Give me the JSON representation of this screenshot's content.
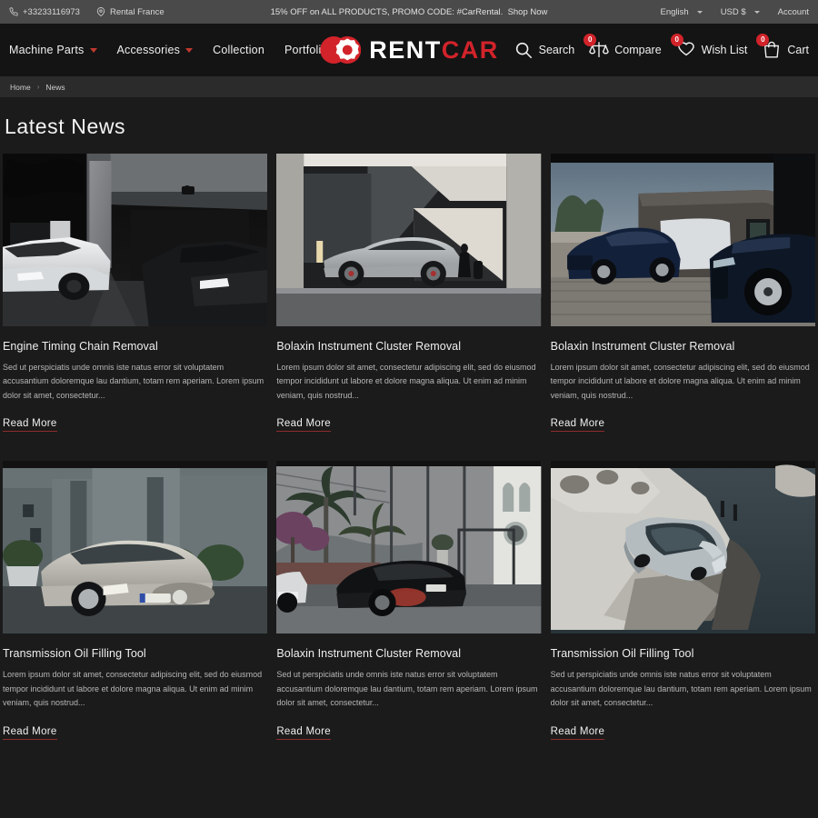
{
  "topbar": {
    "phone": "+33233116973",
    "location": "Rental France",
    "promo": "15% OFF on ALL PRODUCTS, PROMO CODE: #CarRental.",
    "promo_link": "Shop Now",
    "language": "English",
    "currency": "USD $",
    "account": "Account"
  },
  "header": {
    "nav": [
      {
        "label": "Machine Parts",
        "has_caret": true
      },
      {
        "label": "Accessories",
        "has_caret": true
      },
      {
        "label": "Collection",
        "has_caret": false
      },
      {
        "label": "Portfolio",
        "has_caret": false
      }
    ],
    "logo": {
      "rent": "RENT",
      "car": "CAR"
    },
    "actions": [
      {
        "label": "Search",
        "icon": "search-icon",
        "badge": null
      },
      {
        "label": "Compare",
        "icon": "compare-scales-icon",
        "badge": "0"
      },
      {
        "label": "Wish List",
        "icon": "heart-icon",
        "badge": "0"
      },
      {
        "label": "Cart",
        "icon": "shopping-bag-icon",
        "badge": "0"
      }
    ]
  },
  "breadcrumb": {
    "home": "Home",
    "sep": "›",
    "current": "News"
  },
  "page": {
    "title": "Latest News",
    "read_more": "Read More",
    "posts": [
      {
        "title": "Engine Timing Chain Removal",
        "excerpt": "Sed ut perspiciatis unde omnis iste natus error sit voluptatem accusantium doloremque lau dantium, totam rem aperiam. Lorem ipsum dolor sit amet, consectetur...",
        "image": "two-supercars-in-modern-garage-driveway"
      },
      {
        "title": "Bolaxin Instrument Cluster Removal",
        "excerpt": "Lorem ipsum dolor sit amet, consectetur adipiscing elit, sed do eiusmod tempor incididunt ut labore et dolore magna aliqua. Ut enim ad minim veniam, quis nostrud...",
        "image": "silver-sedan-in-concrete-architecture"
      },
      {
        "title": "Bolaxin Instrument Cluster Removal",
        "excerpt": "Lorem ipsum dolor sit amet, consectetur adipiscing elit, sed do eiusmod tempor incididunt ut labore et dolore magna aliqua. Ut enim ad minim veniam, quis nostrud...",
        "image": "dark-blue-suv-on-cobblestone"
      },
      {
        "title": "Transmission Oil Filling Tool",
        "excerpt": "Lorem ipsum dolor sit amet, consectetur adipiscing elit, sed do eiusmod tempor incididunt ut labore et dolore magna aliqua. Ut enim ad minim veniam, quis nostrud...",
        "image": "silver-coupe-with-topiary-planters"
      },
      {
        "title": "Bolaxin Instrument Cluster Removal",
        "excerpt": "Sed ut perspiciatis unde omnis iste natus error sit voluptatem accusantium doloremque lau dantium, totam rem aperiam. Lorem ipsum dolor sit amet, consectetur...",
        "image": "black-sedan-street-with-palms"
      },
      {
        "title": "Transmission Oil Filling Tool",
        "excerpt": "Sed ut perspiciatis unde omnis iste natus error sit voluptatem accusantium doloremque lau dantium, totam rem aperiam. Lorem ipsum dolor sit amet, consectetur...",
        "image": "silver-wagon-on-rocky-shoreline"
      }
    ]
  },
  "colors": {
    "accent": "#d2232a",
    "topbar_bg": "#4a4a4a",
    "header_bg": "#141414",
    "page_bg": "#1b1b1b",
    "breadcrumb_bg": "#2b2b2b"
  }
}
